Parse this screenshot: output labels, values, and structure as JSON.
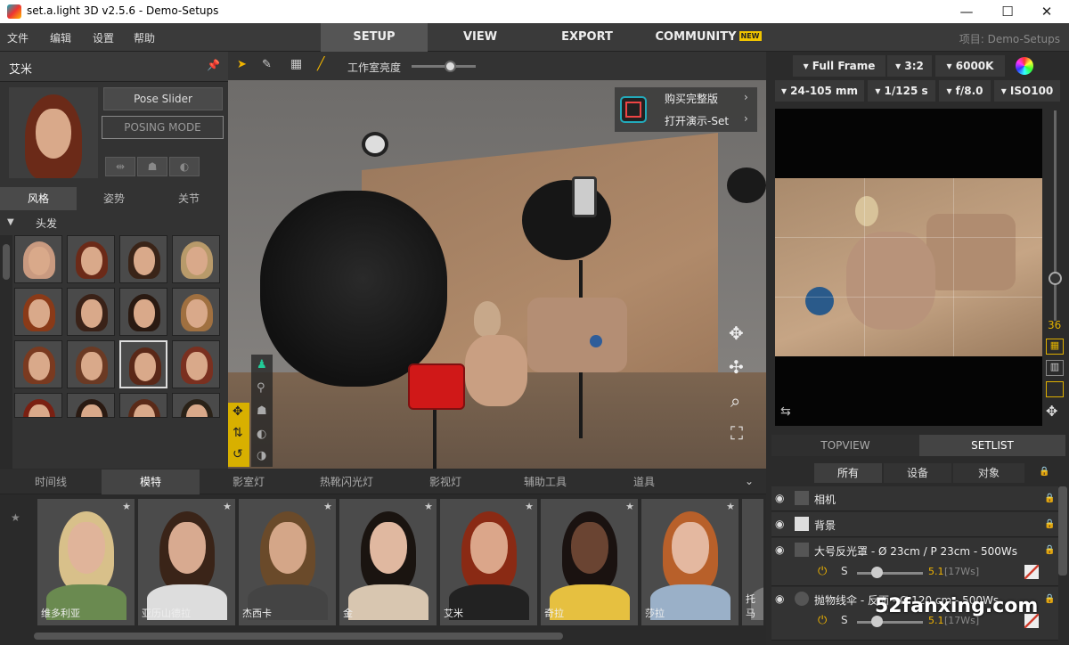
{
  "window": {
    "title": "set.a.light 3D v2.5.6 - Demo-Setups",
    "min": "—",
    "max": "☐",
    "close": "✕"
  },
  "menu": [
    "文件",
    "编辑",
    "设置",
    "帮助"
  ],
  "main_tabs": [
    {
      "label": "SETUP",
      "active": true
    },
    {
      "label": "VIEW",
      "active": false
    },
    {
      "label": "EXPORT",
      "active": false
    },
    {
      "label": "COMMUNITY",
      "active": false,
      "badge": "NEW"
    }
  ],
  "project_label": "项目: Demo-Setups",
  "left_panel": {
    "title": "艾米",
    "pose_slider": "Pose Slider",
    "posing_mode": "POSING MODE",
    "subtabs": [
      "风格",
      "姿势",
      "关节"
    ],
    "section": "头发"
  },
  "viewport": {
    "brightness_label": "工作室亮度",
    "brightness_value": 0.6,
    "promo": [
      "购买完整版",
      "打开演示-Set"
    ]
  },
  "camera": {
    "format": "Full Frame",
    "ratio": "3:2",
    "kelvin": "6000K",
    "lens": "24-105 mm",
    "shutter": "1/125 s",
    "aperture": "f/8.0",
    "iso": "ISO100",
    "focal_readout": "36"
  },
  "view_tabs": [
    {
      "label": "TOPVIEW",
      "active": false
    },
    {
      "label": "SETLIST",
      "active": true
    }
  ],
  "filter_tabs": [
    "所有",
    "设备",
    "对象"
  ],
  "setlist": [
    {
      "label": "相机"
    },
    {
      "label": "背景"
    },
    {
      "label": "大号反光罩 - Ø 23cm / P 23cm - 500Ws",
      "power": "5.1",
      "ws": "[17Ws]"
    },
    {
      "label": "抛物线伞 - 反面 - Ø 120 cm - 500Ws",
      "power": "5.1",
      "ws": "[17Ws]"
    }
  ],
  "bottom_tabs": [
    {
      "label": "时间线",
      "active": false
    },
    {
      "label": "模特",
      "active": true
    },
    {
      "label": "影室灯",
      "active": false
    },
    {
      "label": "热靴闪光灯",
      "active": false
    },
    {
      "label": "影视灯",
      "active": false
    },
    {
      "label": "辅助工具",
      "active": false
    },
    {
      "label": "道具",
      "active": false
    }
  ],
  "models": [
    "维多利亚",
    "亚历山德拉",
    "杰西卡",
    "金",
    "艾米",
    "奇拉",
    "莎拉",
    "托马"
  ],
  "watermark": "52fanxing.com",
  "colors": {
    "bg": "#2b2b2b",
    "panel": "#333333",
    "active_tab": "#555555",
    "power_yellow": "#f0b400",
    "new_badge": "#f0c400",
    "power_red": "#d04030"
  }
}
